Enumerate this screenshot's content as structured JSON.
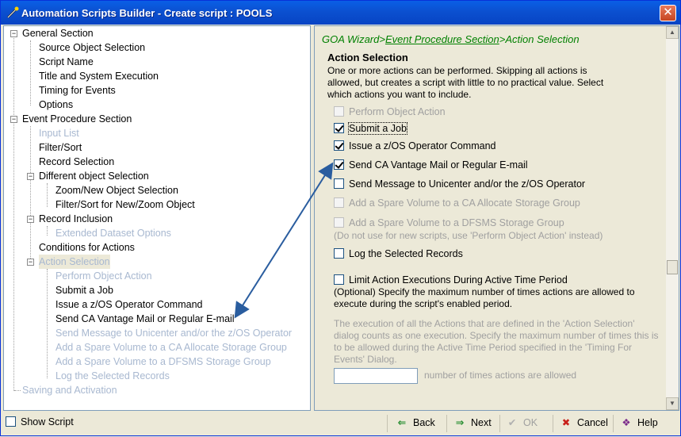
{
  "window": {
    "title": "Automation Scripts Builder - Create script : POOLS",
    "close_glyph": "✕"
  },
  "tree": [
    {
      "label": "General Section",
      "disabled": false,
      "expander": "−"
    },
    {
      "label": "Source Object Selection",
      "disabled": false
    },
    {
      "label": "Script Name",
      "disabled": false
    },
    {
      "label": "Title and System Execution",
      "disabled": false
    },
    {
      "label": "Timing for Events",
      "disabled": false
    },
    {
      "label": "Options",
      "disabled": false
    },
    {
      "label": "Event Procedure Section",
      "disabled": false,
      "expander": "−"
    },
    {
      "label": "Input List",
      "disabled": true
    },
    {
      "label": "Filter/Sort",
      "disabled": false
    },
    {
      "label": "Record Selection",
      "disabled": false
    },
    {
      "label": "Different object Selection",
      "disabled": false,
      "expander": "−"
    },
    {
      "label": "Zoom/New Object Selection",
      "disabled": false
    },
    {
      "label": "Filter/Sort for New/Zoom Object",
      "disabled": false
    },
    {
      "label": "Record Inclusion",
      "disabled": false,
      "expander": "−"
    },
    {
      "label": "Extended Dataset Options",
      "disabled": true
    },
    {
      "label": "Conditions for Actions",
      "disabled": false
    },
    {
      "label": "Action Selection",
      "disabled": true,
      "expander": "−",
      "selected": true
    },
    {
      "label": "Perform Object Action",
      "disabled": true
    },
    {
      "label": "Submit a Job",
      "disabled": false
    },
    {
      "label": "Issue a z/OS Operator Command",
      "disabled": false
    },
    {
      "label": "Send CA Vantage Mail or Regular E-mail",
      "disabled": false
    },
    {
      "label": "Send Message to Unicenter and/or the z/OS Operator",
      "disabled": true
    },
    {
      "label": "Add a Spare Volume to a CA Allocate Storage Group",
      "disabled": true
    },
    {
      "label": "Add a Spare Volume to a DFSMS Storage Group",
      "disabled": true
    },
    {
      "label": "Log the Selected Records",
      "disabled": true
    },
    {
      "label": "Saving and Activation",
      "disabled": true
    }
  ],
  "breadcrumb": {
    "prefix": "GOA Wizard>",
    "link": "Event Procedure Section",
    "suffix": ">Action Selection"
  },
  "main": {
    "title": "Action Selection",
    "intro": "One or more actions can be performed. Skipping all actions is allowed, but creates a script with little to no practical value. Select which actions you want to include.",
    "options": [
      {
        "label": "Perform Object Action",
        "checked": false,
        "disabled": true
      },
      {
        "label": "Submit a Job",
        "checked": true,
        "disabled": false,
        "focused": true
      },
      {
        "label": "Issue a z/OS Operator Command",
        "checked": true,
        "disabled": false
      },
      {
        "label": "Send CA Vantage Mail or Regular E-mail",
        "checked": true,
        "disabled": false
      },
      {
        "label": "Send Message to Unicenter and/or the z/OS Operator",
        "checked": false,
        "disabled": false
      },
      {
        "label": "Add a Spare Volume to a CA Allocate Storage Group",
        "checked": false,
        "disabled": true
      },
      {
        "label": "Add a Spare Volume to a DFSMS Storage Group",
        "checked": false,
        "disabled": true
      },
      {
        "label": "Log the Selected Records",
        "checked": false,
        "disabled": false
      },
      {
        "label": "Limit Action Executions During Active Time Period",
        "checked": false,
        "disabled": false
      }
    ],
    "dfsms_note": "(Do not use for new scripts, use 'Perform Object Action' instead)",
    "limit_note": "(Optional) Specify the maximum number of times actions are allowed to execute during the script's enabled period.",
    "execution_note": "The execution of all the Actions that are defined in the 'Action Selection' dialog counts as one execution. Specify the maximum number of times this is to be allowed during the Active Time Period specified in the 'Timing For Events' Dialog.",
    "count_value": "",
    "count_label": "number of times actions are allowed"
  },
  "footer": {
    "show_script": "Show Script",
    "back": "Back",
    "next": "Next",
    "ok": "OK",
    "cancel": "Cancel",
    "help": "Help"
  },
  "colors": {
    "titlebar": "#0b50d0",
    "breadcrumb": "#008000",
    "arrow": "#2a5d9f",
    "disabled_text": "#a8b8d0"
  }
}
